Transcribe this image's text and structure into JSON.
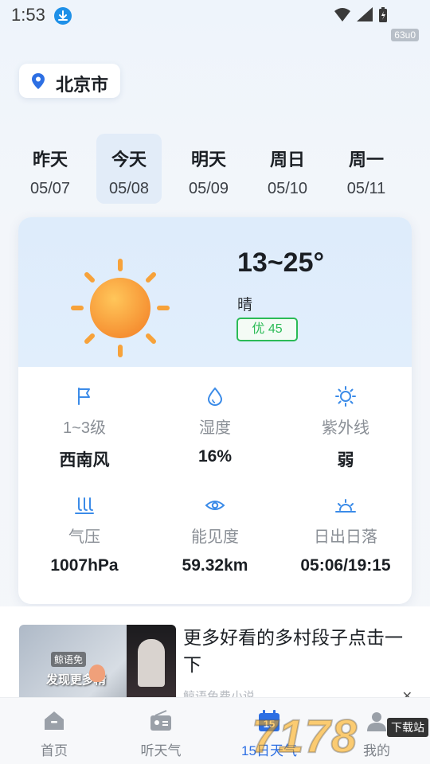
{
  "status_bar": {
    "time": "1:53",
    "net_badge": "63u0"
  },
  "location": {
    "city": "北京市"
  },
  "days": [
    {
      "name": "昨天",
      "date": "05/07",
      "active": false
    },
    {
      "name": "今天",
      "date": "05/08",
      "active": true
    },
    {
      "name": "明天",
      "date": "05/09",
      "active": false
    },
    {
      "name": "周日",
      "date": "05/10",
      "active": false
    },
    {
      "name": "周一",
      "date": "05/11",
      "active": false
    }
  ],
  "weather": {
    "temp_range": "13~25°",
    "condition": "晴",
    "aqi": "优 45",
    "aqi_color": "#2bbb56",
    "icon": "sunny-icon"
  },
  "stats": [
    {
      "icon": "flag-icon",
      "label": "1~3级",
      "value": "西南风"
    },
    {
      "icon": "droplet-icon",
      "label": "湿度",
      "value": "16%"
    },
    {
      "icon": "sun-outline-icon",
      "label": "紫外线",
      "value": "弱"
    },
    {
      "icon": "pressure-icon",
      "label": "气压",
      "value": "1007hPa"
    },
    {
      "icon": "eye-icon",
      "label": "能见度",
      "value": "59.32km"
    },
    {
      "icon": "sunrise-icon",
      "label": "日出日落",
      "value": "05:06/19:15"
    }
  ],
  "ad": {
    "title": "更多好看的多村段子点击一下",
    "source": "鲸语免费小说",
    "close": "✕",
    "thumb_tag": "鲸语免",
    "thumb_hook": "发现更多精"
  },
  "nav": [
    {
      "label": "首页",
      "icon": "home-icon",
      "active": false
    },
    {
      "label": "听天气",
      "icon": "radio-icon",
      "active": false
    },
    {
      "label": "15日天气",
      "icon": "calendar-15-icon",
      "active": true
    },
    {
      "label": "我的",
      "icon": "profile-icon",
      "active": false
    }
  ],
  "watermark": {
    "text": "7178",
    "badge": "下载站"
  },
  "colors": {
    "accent": "#2d6fe3",
    "icon_blue": "#3b8be8",
    "sun_orange": "#f7a23a"
  }
}
